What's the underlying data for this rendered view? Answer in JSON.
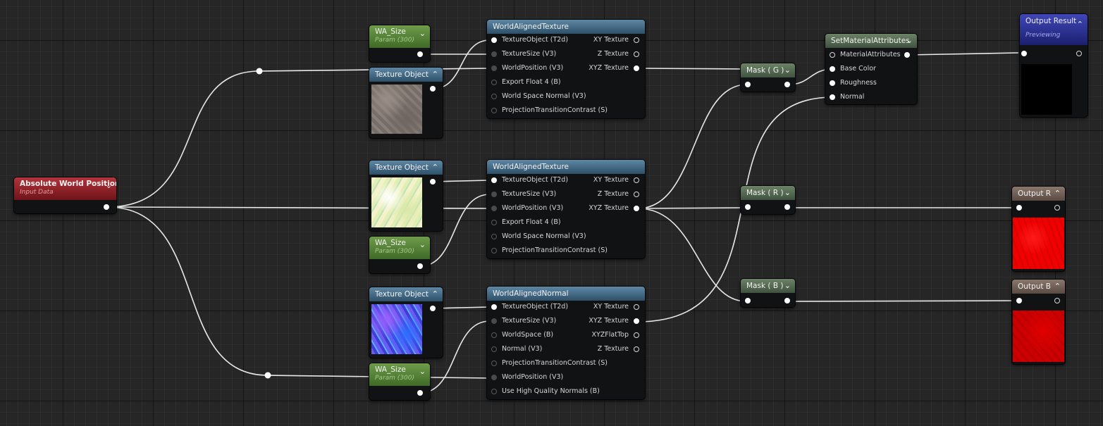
{
  "nodes": {
    "wa_size_top": {
      "title": "WA_Size",
      "subtitle": "Param (300)"
    },
    "wa_size_mid": {
      "title": "WA_Size",
      "subtitle": "Param (300)"
    },
    "wa_size_bot": {
      "title": "WA_Size",
      "subtitle": "Param (300)"
    },
    "texobj_1": {
      "title": "Texture Object"
    },
    "texobj_2": {
      "title": "Texture Object"
    },
    "texobj_3": {
      "title": "Texture Object"
    },
    "abs_world_pos": {
      "title": "Absolute World Position",
      "subtitle": "Input Data"
    },
    "wat_1": {
      "title": "WorldAlignedTexture",
      "inputs": [
        "TextureObject (T2d)",
        "TextureSize (V3)",
        "WorldPosition (V3)",
        "Export Float 4 (B)",
        "World Space Normal (V3)",
        "ProjectionTransitionContrast (S)"
      ],
      "outputs": [
        "XY Texture",
        "Z Texture",
        "XYZ Texture"
      ]
    },
    "wat_2": {
      "title": "WorldAlignedTexture",
      "inputs": [
        "TextureObject (T2d)",
        "TextureSize (V3)",
        "WorldPosition (V3)",
        "Export Float 4 (B)",
        "World Space Normal (V3)",
        "ProjectionTransitionContrast (S)"
      ],
      "outputs": [
        "XY Texture",
        "Z Texture",
        "XYZ Texture"
      ]
    },
    "wan": {
      "title": "WorldAlignedNormal",
      "inputs": [
        "TextureObject (T2d)",
        "TextureSize (V3)",
        "WorldSpace (B)",
        "Normal (V3)",
        "ProjectionTransitionContrast (S)",
        "WorldPosition (V3)",
        "Use High Quality Normals (B)"
      ],
      "outputs": [
        "XY Texture",
        "XYZ Texture",
        "XYZFlatTop",
        "Z Texture"
      ]
    },
    "mask_g": {
      "title": "Mask ( G )"
    },
    "mask_r": {
      "title": "Mask ( R )"
    },
    "mask_b": {
      "title": "Mask ( B )"
    },
    "set_mat_attr": {
      "title": "SetMaterialAttributes",
      "inputs": [
        "MaterialAttributes",
        "Base Color",
        "Roughness",
        "Normal"
      ]
    },
    "output_result": {
      "title": "Output Result",
      "subtitle": "Previewing"
    },
    "output_r": {
      "title": "Output R"
    },
    "output_b": {
      "title": "Output B"
    }
  },
  "colors": {
    "param_header": "#5a8a3c",
    "texture_header": "#3f6a89",
    "input_header": "#9a2a30",
    "mask_header": "#566b52",
    "output_header": "#2a2f96",
    "preview_red": "#ff0000"
  },
  "icons": {
    "expand": "chevron-down-icon",
    "collapse": "chevron-up-icon"
  }
}
